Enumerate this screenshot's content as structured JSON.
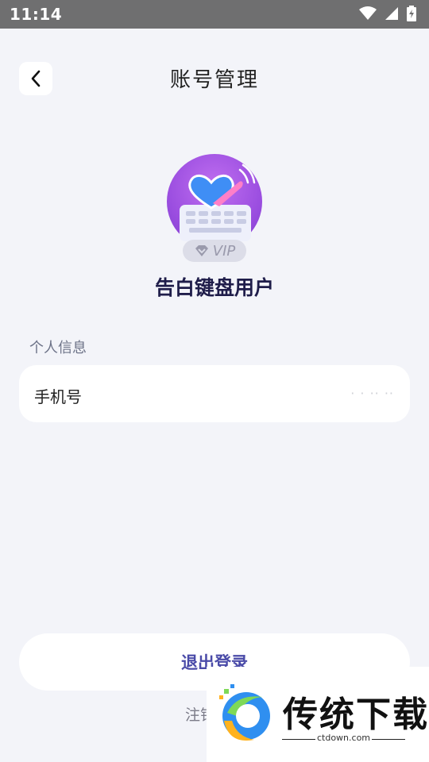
{
  "status_bar": {
    "time": "11:14"
  },
  "header": {
    "title": "账号管理"
  },
  "profile": {
    "vip_label": "VIP",
    "username": "告白键盘用户"
  },
  "personal_info": {
    "section_label": "个人信息",
    "phone_label": "手机号",
    "phone_value": "· · ·· ··"
  },
  "actions": {
    "logout_label": "退出登录",
    "deregister_label": "注销"
  },
  "watermark": {
    "brand": "传统下载",
    "domain": "ctdown.com"
  },
  "colors": {
    "background": "#f3f4f9",
    "status_bar": "#6f6f70",
    "title_text": "#1f1d4a",
    "logout_text": "#4a4ba8",
    "avatar_purple": "#9b4ee0"
  }
}
